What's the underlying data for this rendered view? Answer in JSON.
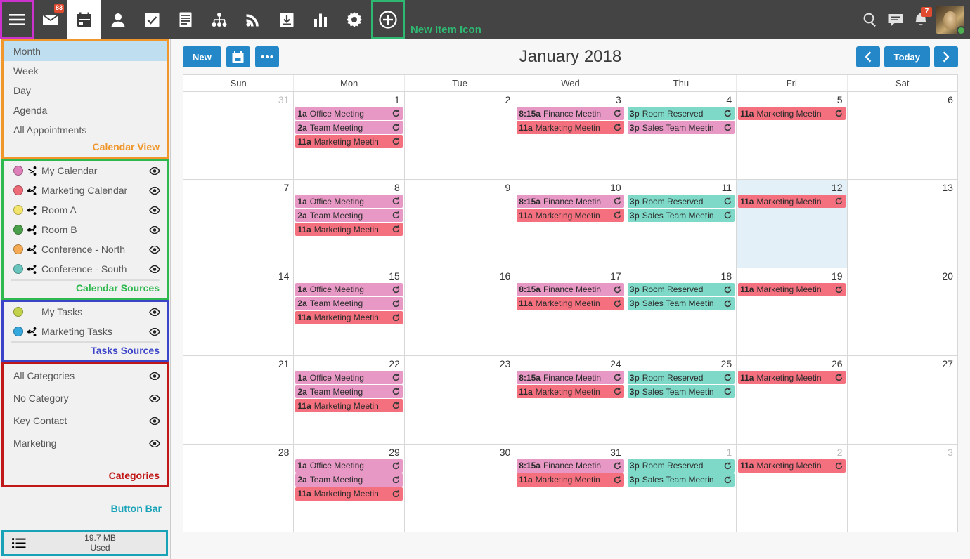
{
  "topbar": {
    "hamburger": {
      "name": "menu-icon",
      "highlight": "#cc33cc"
    },
    "items": [
      {
        "icon": "mail-icon",
        "label": "Mail",
        "badge": "83",
        "active": false
      },
      {
        "icon": "calendar-icon",
        "label": "Calendar",
        "active": true
      },
      {
        "icon": "contacts-icon",
        "label": "Contacts",
        "active": false
      },
      {
        "icon": "tasks-icon",
        "label": "Tasks",
        "active": false
      },
      {
        "icon": "notes-icon",
        "label": "Notes",
        "active": false
      },
      {
        "icon": "org-chart-icon",
        "label": "Org Chart",
        "active": false
      },
      {
        "icon": "feeds-icon",
        "label": "Feeds",
        "active": false
      },
      {
        "icon": "archive-icon",
        "label": "Archive",
        "active": false
      },
      {
        "icon": "reports-icon",
        "label": "Reports",
        "active": false
      },
      {
        "icon": "settings-icon",
        "label": "Settings",
        "active": false
      },
      {
        "icon": "new-item-icon",
        "label": "New Item",
        "active": false,
        "highlight": "#2eb872"
      }
    ],
    "new_item_caption": "New Item Icon",
    "right_items": [
      {
        "icon": "search-icon",
        "label": "Search"
      },
      {
        "icon": "chat-icon",
        "label": "Chat"
      },
      {
        "icon": "bell-icon",
        "label": "Notifications",
        "badge": "7"
      }
    ],
    "avatar": {
      "name": "avatar",
      "presence": "online"
    }
  },
  "sidebar": {
    "view_panel": {
      "label": "Calendar View",
      "accent": "#f0962a",
      "items": [
        {
          "label": "Month",
          "selected": true
        },
        {
          "label": "Week",
          "selected": false
        },
        {
          "label": "Day",
          "selected": false
        },
        {
          "label": "Agenda",
          "selected": false
        },
        {
          "label": "All Appointments",
          "selected": false
        }
      ]
    },
    "calendar_sources": {
      "label": "Calendar Sources",
      "accent": "#2eb84d",
      "items": [
        {
          "label": "My Calendar",
          "color": "#dd7fb8",
          "share": "private-share-icon"
        },
        {
          "label": "Marketing Calendar",
          "color": "#ee6b78",
          "share": "share-icon"
        },
        {
          "label": "Room A",
          "color": "#f2e36a",
          "share": "share-icon"
        },
        {
          "label": "Room B",
          "color": "#4aa04a",
          "share": "share-icon"
        },
        {
          "label": "Conference - North",
          "color": "#f5ab55",
          "share": "share-icon"
        },
        {
          "label": "Conference - South",
          "color": "#68c4bd",
          "share": "share-icon"
        }
      ]
    },
    "tasks_sources": {
      "label": "Tasks Sources",
      "accent": "#3b44c8",
      "items": [
        {
          "label": "My Tasks",
          "color": "#c2d24b",
          "share": ""
        },
        {
          "label": "Marketing Tasks",
          "color": "#35a8dd",
          "share": "share-icon"
        }
      ]
    },
    "categories": {
      "label": "Categories",
      "accent": "#c01818",
      "items": [
        {
          "label": "All Categories"
        },
        {
          "label": "No Category"
        },
        {
          "label": "Key Contact"
        },
        {
          "label": "Marketing"
        }
      ]
    },
    "button_bar_label": "Button Bar",
    "statusbar": {
      "icon": "list-icon",
      "line1": "19.7 MB",
      "line2": "Used"
    }
  },
  "toolbar": {
    "new_label": "New",
    "date_picker_icon": "calendar-picker-icon",
    "more_icon": "more-options-icon",
    "prev_icon": "chevron-left-icon",
    "today_label": "Today",
    "next_icon": "chevron-right-icon"
  },
  "calendar": {
    "title": "January 2018",
    "day_headers": [
      "Sun",
      "Mon",
      "Tue",
      "Wed",
      "Thu",
      "Fri",
      "Sat"
    ],
    "weeks": [
      [
        {
          "num": "31",
          "other": true,
          "events": []
        },
        {
          "num": "1",
          "events": [
            {
              "time": "1a",
              "name": "Office Meeting",
              "color": "pink",
              "recurring": true
            },
            {
              "time": "2a",
              "name": "Team Meeting",
              "color": "pink",
              "recurring": true
            },
            {
              "time": "11a",
              "name": "Marketing Meetin",
              "color": "red",
              "recurring": true
            }
          ]
        },
        {
          "num": "2",
          "events": []
        },
        {
          "num": "3",
          "events": [
            {
              "time": "8:15a",
              "name": "Finance Meetin",
              "color": "pink",
              "recurring": true
            },
            {
              "time": "11a",
              "name": "Marketing Meetin",
              "color": "red",
              "recurring": true
            }
          ]
        },
        {
          "num": "4",
          "events": [
            {
              "time": "3p",
              "name": "Room Reserved",
              "color": "teal",
              "recurring": true
            },
            {
              "time": "3p",
              "name": "Sales Team Meetin",
              "color": "pink",
              "recurring": true
            }
          ]
        },
        {
          "num": "5",
          "events": [
            {
              "time": "11a",
              "name": "Marketing Meetin",
              "color": "red",
              "recurring": true
            }
          ]
        },
        {
          "num": "6",
          "events": []
        }
      ],
      [
        {
          "num": "7",
          "events": []
        },
        {
          "num": "8",
          "events": [
            {
              "time": "1a",
              "name": "Office Meeting",
              "color": "pink",
              "recurring": true
            },
            {
              "time": "2a",
              "name": "Team Meeting",
              "color": "pink",
              "recurring": true
            },
            {
              "time": "11a",
              "name": "Marketing Meetin",
              "color": "red",
              "recurring": true
            }
          ]
        },
        {
          "num": "9",
          "events": []
        },
        {
          "num": "10",
          "events": [
            {
              "time": "8:15a",
              "name": "Finance Meetin",
              "color": "pink",
              "recurring": true
            },
            {
              "time": "11a",
              "name": "Marketing Meetin",
              "color": "red",
              "recurring": true
            }
          ]
        },
        {
          "num": "11",
          "events": [
            {
              "time": "3p",
              "name": "Room Reserved",
              "color": "teal",
              "recurring": true
            },
            {
              "time": "3p",
              "name": "Sales Team Meetin",
              "color": "teal",
              "recurring": true
            }
          ]
        },
        {
          "num": "12",
          "today": true,
          "events": [
            {
              "time": "11a",
              "name": "Marketing Meetin",
              "color": "red",
              "recurring": true
            }
          ]
        },
        {
          "num": "13",
          "events": []
        }
      ],
      [
        {
          "num": "14",
          "events": []
        },
        {
          "num": "15",
          "events": [
            {
              "time": "1a",
              "name": "Office Meeting",
              "color": "pink",
              "recurring": true
            },
            {
              "time": "2a",
              "name": "Team Meeting",
              "color": "pink",
              "recurring": true
            },
            {
              "time": "11a",
              "name": "Marketing Meetin",
              "color": "red",
              "recurring": true
            }
          ]
        },
        {
          "num": "16",
          "events": []
        },
        {
          "num": "17",
          "events": [
            {
              "time": "8:15a",
              "name": "Finance Meetin",
              "color": "pink",
              "recurring": true
            },
            {
              "time": "11a",
              "name": "Marketing Meetin",
              "color": "red",
              "recurring": true
            }
          ]
        },
        {
          "num": "18",
          "events": [
            {
              "time": "3p",
              "name": "Room Reserved",
              "color": "teal",
              "recurring": true
            },
            {
              "time": "3p",
              "name": "Sales Team Meetin",
              "color": "teal",
              "recurring": true
            }
          ]
        },
        {
          "num": "19",
          "events": [
            {
              "time": "11a",
              "name": "Marketing Meetin",
              "color": "red",
              "recurring": true
            }
          ]
        },
        {
          "num": "20",
          "events": []
        }
      ],
      [
        {
          "num": "21",
          "events": []
        },
        {
          "num": "22",
          "events": [
            {
              "time": "1a",
              "name": "Office Meeting",
              "color": "pink",
              "recurring": true
            },
            {
              "time": "2a",
              "name": "Team Meeting",
              "color": "pink",
              "recurring": true
            },
            {
              "time": "11a",
              "name": "Marketing Meetin",
              "color": "red",
              "recurring": true
            }
          ]
        },
        {
          "num": "23",
          "events": []
        },
        {
          "num": "24",
          "events": [
            {
              "time": "8:15a",
              "name": "Finance Meetin",
              "color": "pink",
              "recurring": true
            },
            {
              "time": "11a",
              "name": "Marketing Meetin",
              "color": "red",
              "recurring": true
            }
          ]
        },
        {
          "num": "25",
          "events": [
            {
              "time": "3p",
              "name": "Room Reserved",
              "color": "teal",
              "recurring": true
            },
            {
              "time": "3p",
              "name": "Sales Team Meetin",
              "color": "teal",
              "recurring": true
            }
          ]
        },
        {
          "num": "26",
          "events": [
            {
              "time": "11a",
              "name": "Marketing Meetin",
              "color": "red",
              "recurring": true
            }
          ]
        },
        {
          "num": "27",
          "events": []
        }
      ],
      [
        {
          "num": "28",
          "events": []
        },
        {
          "num": "29",
          "events": [
            {
              "time": "1a",
              "name": "Office Meeting",
              "color": "pink",
              "recurring": true
            },
            {
              "time": "2a",
              "name": "Team Meeting",
              "color": "pink",
              "recurring": true
            },
            {
              "time": "11a",
              "name": "Marketing Meetin",
              "color": "red",
              "recurring": true
            }
          ]
        },
        {
          "num": "30",
          "events": []
        },
        {
          "num": "31",
          "events": [
            {
              "time": "8:15a",
              "name": "Finance Meetin",
              "color": "pink",
              "recurring": true
            },
            {
              "time": "11a",
              "name": "Marketing Meetin",
              "color": "red",
              "recurring": true
            }
          ]
        },
        {
          "num": "1",
          "other": true,
          "events": [
            {
              "time": "3p",
              "name": "Room Reserved",
              "color": "teal",
              "recurring": true
            },
            {
              "time": "3p",
              "name": "Sales Team Meetin",
              "color": "teal",
              "recurring": true
            }
          ]
        },
        {
          "num": "2",
          "other": true,
          "events": [
            {
              "time": "11a",
              "name": "Marketing Meetin",
              "color": "red",
              "recurring": true
            }
          ]
        },
        {
          "num": "3",
          "other": true,
          "events": []
        }
      ]
    ]
  }
}
